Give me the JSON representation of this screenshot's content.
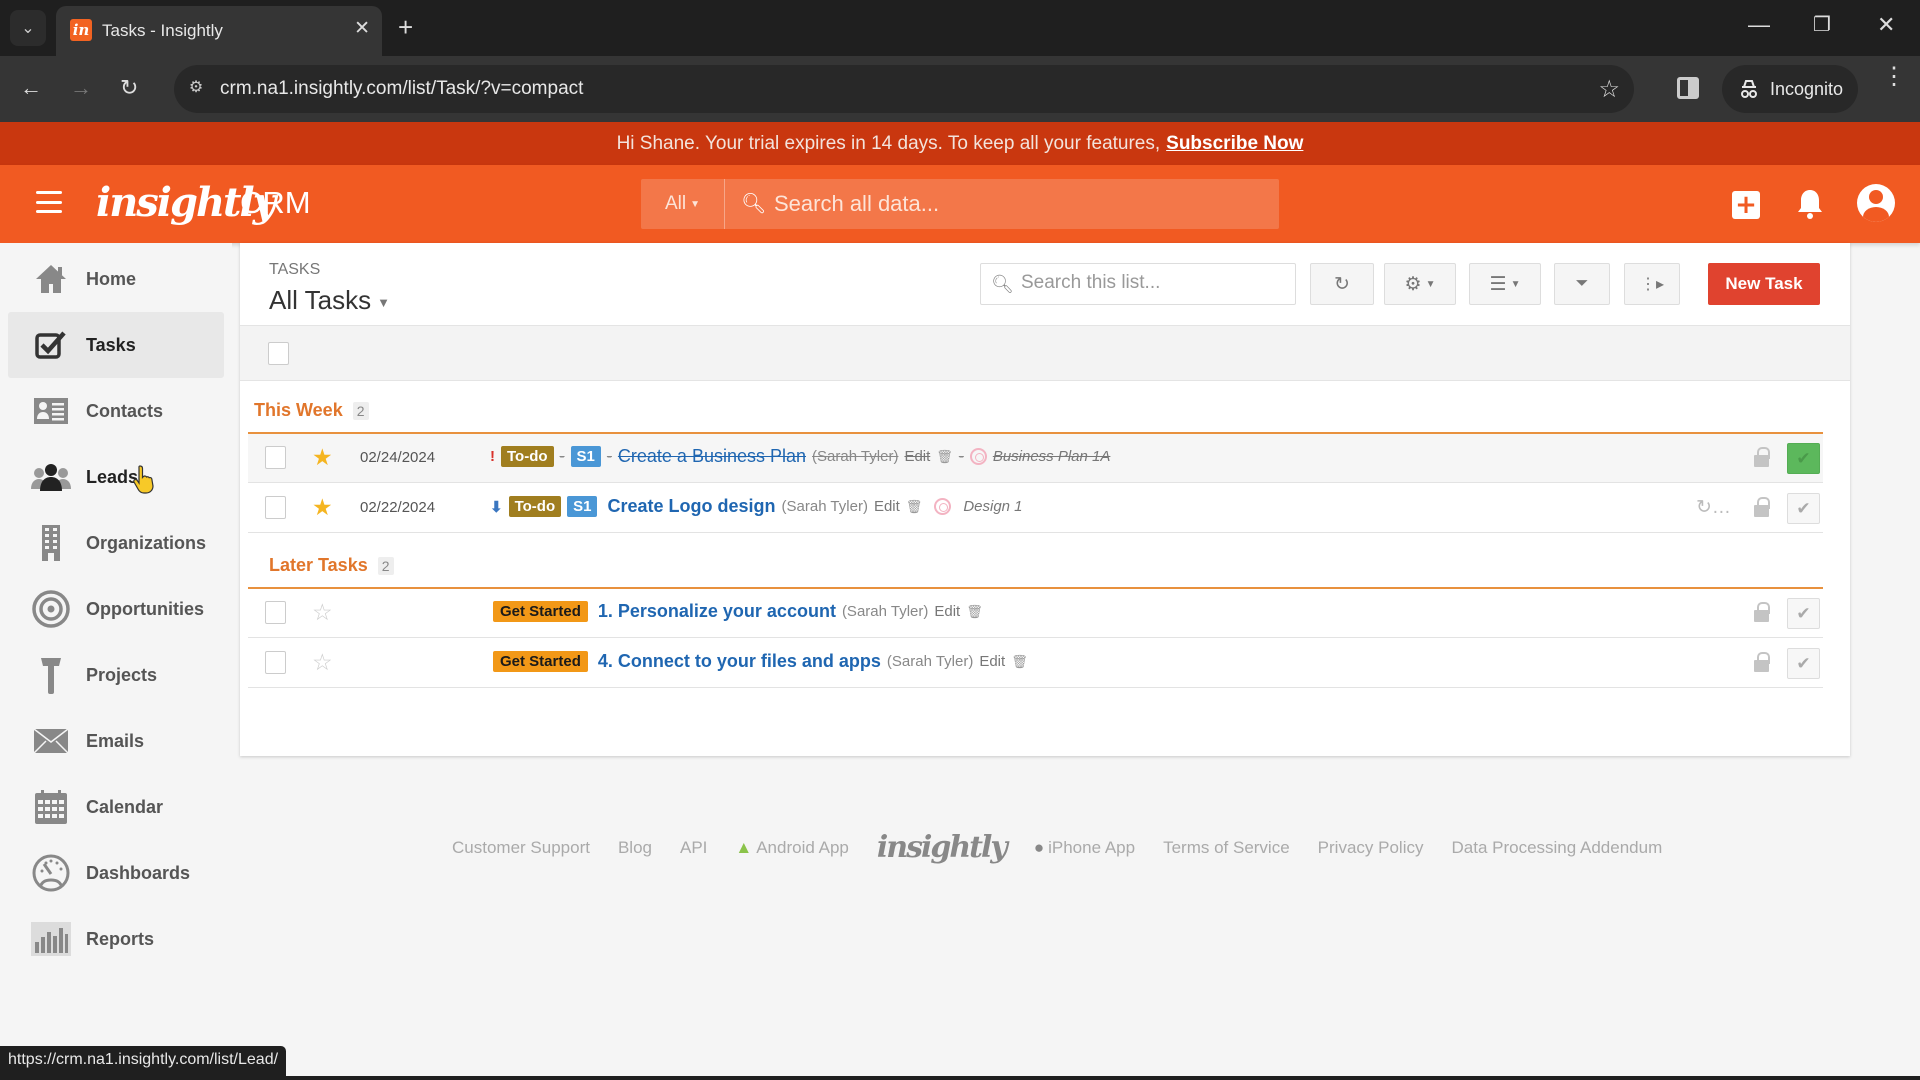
{
  "browser": {
    "tab_title": "Tasks - Insightly",
    "favicon_letter": "in",
    "url": "crm.na1.insightly.com/list/Task/?v=compact",
    "profile_label": "Incognito",
    "status_url": "https://crm.na1.insightly.com/list/Lead/"
  },
  "banner": {
    "message": "Hi Shane. Your trial expires in 14 days. To keep all your features,",
    "link_label": "Subscribe Now"
  },
  "header": {
    "logo": "insightly",
    "product": "CRM",
    "search_scope": "All",
    "search_placeholder": "Search all data..."
  },
  "sidebar": {
    "active": "Tasks",
    "hover": "Leads",
    "items": [
      {
        "label": "Home",
        "icon": "home-icon"
      },
      {
        "label": "Tasks",
        "icon": "tasks-checkbox-icon"
      },
      {
        "label": "Contacts",
        "icon": "contact-card-icon"
      },
      {
        "label": "Leads",
        "icon": "leads-people-icon"
      },
      {
        "label": "Organizations",
        "icon": "building-icon"
      },
      {
        "label": "Opportunities",
        "icon": "target-icon"
      },
      {
        "label": "Projects",
        "icon": "hammer-icon"
      },
      {
        "label": "Emails",
        "icon": "envelope-icon"
      },
      {
        "label": "Calendar",
        "icon": "calendar-icon"
      },
      {
        "label": "Dashboards",
        "icon": "gauge-icon"
      },
      {
        "label": "Reports",
        "icon": "bar-chart-icon"
      }
    ]
  },
  "main": {
    "section_label": "TASKS",
    "view_name": "All Tasks",
    "list_search_placeholder": "Search this list...",
    "new_task_label": "New Task",
    "groups": [
      {
        "title": "This Week",
        "count": "2",
        "tasks": [
          {
            "starred": true,
            "date": "02/24/2024",
            "priority": "high",
            "priority_glyph": "!",
            "status": "To-do",
            "stage": "S1",
            "name": "Create a Business Plan",
            "owner": "(Sarah Tyler)",
            "edit": "Edit",
            "project": "Business Plan 1A",
            "completed": true,
            "recurring": false
          },
          {
            "starred": true,
            "date": "02/22/2024",
            "priority": "low",
            "priority_glyph": "⬇",
            "status": "To-do",
            "stage": "S1",
            "name": "Create Logo design",
            "owner": "(Sarah Tyler)",
            "edit": "Edit",
            "project": "Design 1",
            "completed": false,
            "recurring": true
          }
        ]
      },
      {
        "title": "Later Tasks",
        "count": "2",
        "tasks": [
          {
            "starred": false,
            "date": "",
            "status": "Get Started",
            "name": "1. Personalize your account",
            "owner": "(Sarah Tyler)",
            "edit": "Edit",
            "completed": false
          },
          {
            "starred": false,
            "date": "",
            "status": "Get Started",
            "name": "4. Connect to your files and apps",
            "owner": "(Sarah Tyler)",
            "edit": "Edit",
            "completed": false
          }
        ]
      }
    ]
  },
  "footer": {
    "links": [
      "Customer Support",
      "Blog",
      "API",
      "Android App",
      "iPhone App",
      "Terms of Service",
      "Privacy Policy",
      "Data Processing Addendum"
    ],
    "logo": "insightly"
  },
  "colors": {
    "brand_orange": "#f15a22",
    "banner_red": "#c9370f",
    "new_task_red": "#e0432f",
    "group_orange": "#e1762b",
    "link_blue": "#1f66b1",
    "complete_green": "#5cb85c"
  }
}
